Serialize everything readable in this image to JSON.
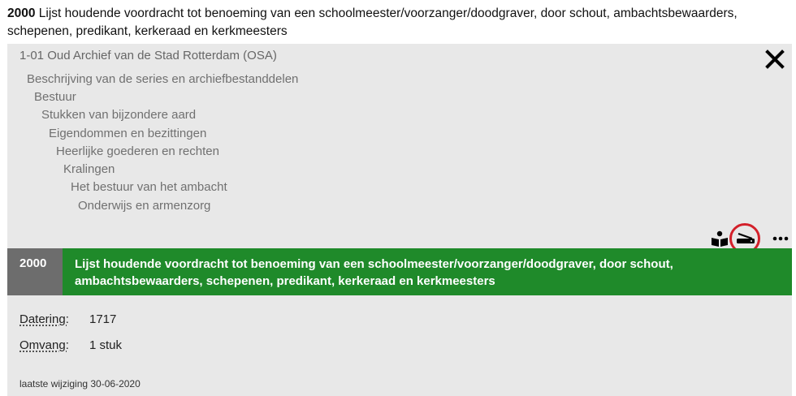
{
  "record": {
    "number": "2000",
    "title": "Lijst houdende voordracht tot benoeming van een schoolmeester/voorzanger/doodgraver, door schout, ambachtsbewaarders, schepenen, predikant, kerkeraad en kerkmeesters"
  },
  "archive": {
    "root": "1-01 Oud Archief van de Stad Rotterdam (OSA)",
    "tree": [
      "Beschrijving van de series en archiefbestanddelen",
      "Bestuur",
      "Stukken van bijzondere aard",
      "Eigendommen en bezittingen",
      "Heerlijke goederen en rechten",
      "Kralingen",
      "Het bestuur van het ambacht",
      "Onderwijs en armenzorg"
    ]
  },
  "details": {
    "datering_label": "Datering:",
    "datering_value": "1717",
    "omvang_label": "Omvang:",
    "omvang_value": "1 stuk"
  },
  "footer": "laatste wijziging 30-06-2020",
  "icons": [
    "reader-icon",
    "scanner-icon",
    "more-icon",
    "close-icon"
  ],
  "colors": {
    "green_bar": "#1f8a2a",
    "gray_bar": "#6d6d6d",
    "highlight_ring": "#d3202a"
  }
}
